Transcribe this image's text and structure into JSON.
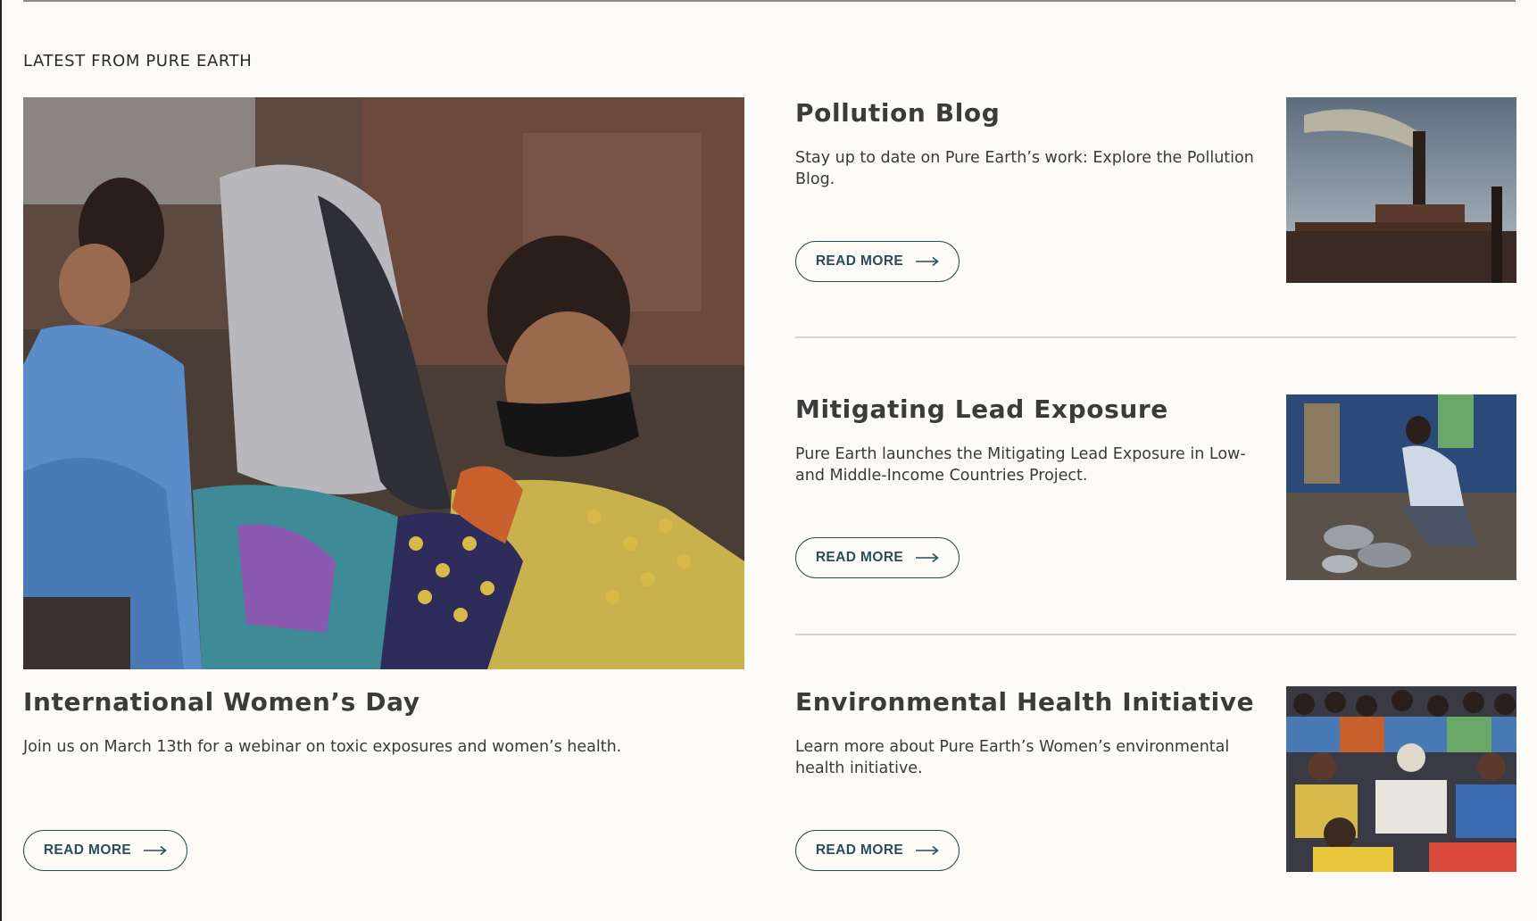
{
  "section": {
    "heading": "LATEST FROM PURE EARTH"
  },
  "feature": {
    "title": "International Women’s Day",
    "description": "Join us on March 13th for a webinar on toxic exposures and women’s health.",
    "button_label": "READ MORE",
    "image_icon": "women-sitting-photo"
  },
  "items": [
    {
      "title": "Pollution Blog",
      "description": "Stay up to date on Pure Earth’s work: Explore the Pollution Blog.",
      "button_label": "READ MORE",
      "image_icon": "smokestack-photo"
    },
    {
      "title": "Mitigating Lead Exposure",
      "description": "Pure Earth launches the Mitigating Lead Exposure in Low- and Middle-Income Countries Project.",
      "button_label": "READ MORE",
      "image_icon": "cookware-testing-photo"
    },
    {
      "title": "Environmental Health Initiative",
      "description": "Learn more about Pure Earth’s Women’s environmental health initiative.",
      "button_label": "READ MORE",
      "image_icon": "women-gathering-photo"
    }
  ],
  "colors": {
    "background": "#fcfbf7",
    "button_border": "#2b4a52",
    "button_text": "#2a4d57",
    "divider": "#d6d4cf"
  }
}
